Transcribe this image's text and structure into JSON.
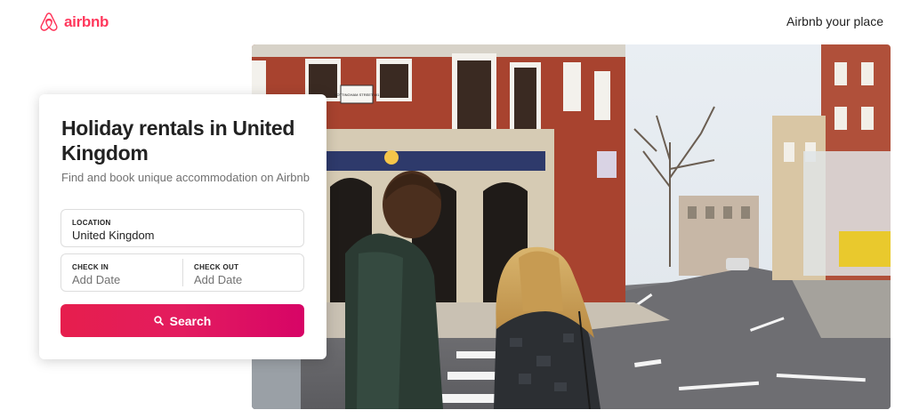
{
  "header": {
    "brand": "airbnb",
    "host_link": "Airbnb your place",
    "brand_color": "#ff385c"
  },
  "card": {
    "title": "Holiday rentals in United Kingdom",
    "subtitle": "Find and book unique accommodation on Airbnb",
    "location": {
      "label": "LOCATION",
      "value": "United Kingdom"
    },
    "check_in": {
      "label": "CHECK IN",
      "placeholder": "Add Date"
    },
    "check_out": {
      "label": "CHECK OUT",
      "placeholder": "Add Date"
    },
    "search_button": {
      "label": "Search",
      "icon": "search-icon"
    }
  },
  "hero": {
    "signs": {
      "street": "NOTTINGHAM STREET W1"
    }
  },
  "colors": {
    "button_start": "#e61e4d",
    "button_end": "#d70466",
    "text_primary": "#222222",
    "text_secondary": "#717171"
  }
}
